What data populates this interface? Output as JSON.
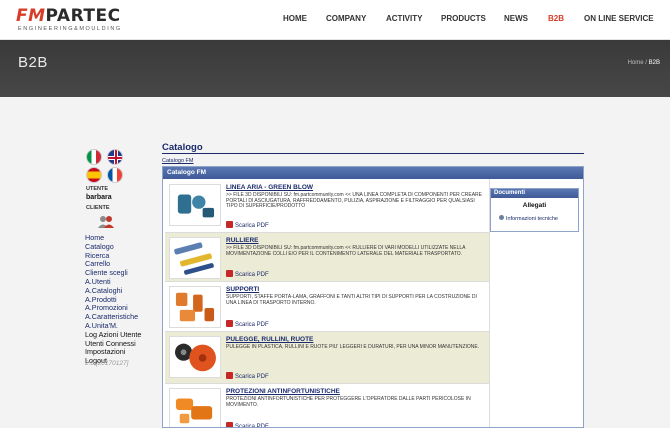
{
  "brand": {
    "logo_fm": "FM",
    "logo_partec": "PARTEC",
    "logo_sub": "ENGINEERING&MOULDING"
  },
  "nav": [
    {
      "label": "HOME",
      "active": false
    },
    {
      "label": "COMPANY",
      "active": false
    },
    {
      "label": "ACTIVITY",
      "active": false
    },
    {
      "label": "PRODUCTS",
      "active": false
    },
    {
      "label": "NEWS",
      "active": false
    },
    {
      "label": "B2B",
      "active": true
    },
    {
      "label": "ON LINE SERVICE",
      "active": false
    }
  ],
  "band": {
    "title": "B2B",
    "breadcrumb_home": "Home",
    "breadcrumb_sep": " / ",
    "breadcrumb_current": "B2B"
  },
  "user": {
    "label_user": "UTENTE",
    "name": "barbara",
    "label_client": "CLIENTE"
  },
  "menu": [
    "Home",
    "Catalogo",
    "Ricerca",
    "Carrello",
    "Cliente scegli",
    "A.Utenti",
    "A.Cataloghi",
    "A.Prodotti",
    "A.Promozioni",
    "A.Caratteristiche",
    "A.Unita'M.",
    "Log Azioni Utente",
    "Utenti Connessi",
    "Impostazioni",
    "Logout"
  ],
  "version": "2.0 [20170127]",
  "catalog": {
    "title": "Catalogo",
    "breadcrumb": "Catalogo FM",
    "panel_header": "Catalogo FM",
    "pdf_label": "Scarica PDF",
    "items": [
      {
        "title": "LINEA ARIA - GREEN BLOW",
        "desc": ">> FILE 3D DISPONIBILI SU: fm.partcommunity.com << UNA LINEA COMPLETA DI COMPONENTI PER CREARE PORTALI DI ASCIUGATURA, RAFFREDDAMENTO, PULIZIA, ASPIRAZIONE E FILTRAGGIO PER QUALSIASI TIPO DI SUPERFICIE/PRODOTTO"
      },
      {
        "title": "RULLIERE",
        "desc": ">> FILE 3D DISPONIBILI SU: fm.partcommunity.com << RULLIERE DI VARI MODELLI UTILIZZATE NELLA MOVIMENTAZIONE COLLI E/O PER IL CONTENIMENTO LATERALE DEL MATERIALE TRASPORTATO."
      },
      {
        "title": "SUPPORTI",
        "desc": "SUPPORTI, STAFFE PORTA-LAMA, GRAFFONI E TANTI ALTRI TIPI DI SUPPORTI PER LA COSTRUZIONE DI UNA LINEA DI TRASPORTO INTERNO."
      },
      {
        "title": "PULEGGE, RULLINI, RUOTE",
        "desc": "PULEGGE IN PLASTICA, RULLINI E RUOTE PIU' LEGGERI E DURATURI, PER UNA MINOR MANUTENZIONE."
      },
      {
        "title": "PROTEZIONI ANTINFORTUNISTICHE",
        "desc": "PROTEZIONI ANTINFORTUNISTICHE PER PROTEGGERE L'OPERATORE DALLE PARTI PERICOLOSE IN MOVIMENTO."
      }
    ]
  },
  "documents": {
    "header": "Documenti",
    "subtitle": "Allegati",
    "link": "Informazioni tecniche"
  },
  "colors": {
    "accent": "#d63c28",
    "link": "#1a2a6c",
    "panel_header": "#4a66a3",
    "row_alt": "#ecebd6",
    "band": "#404040"
  }
}
